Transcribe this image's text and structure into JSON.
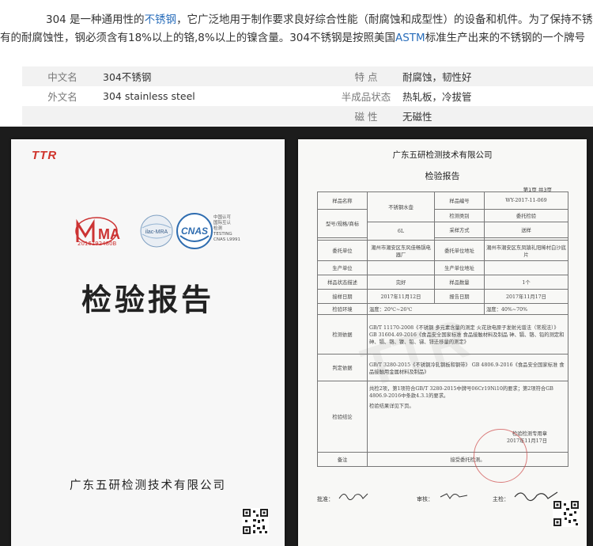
{
  "intro": {
    "line1_a": "304 是一种通用性的",
    "line1_kw": "不锈钢",
    "line1_b": "，它广泛地用于制作要求良好综合性能（耐腐蚀和成型性）的设备和机件。为了保持不锈钢",
    "line2_a": "有的耐腐蚀性，钢必须含有18%以上的铬,8%以上的镍含量。304不锈钢是按照美国",
    "line2_kw": "ASTM",
    "line2_b": "标准生产出来的不锈钢的一个牌号"
  },
  "specs": [
    {
      "k1": "中文名",
      "v1": "304不锈钢",
      "k2": "特  点",
      "v2": "耐腐蚀，韧性好"
    },
    {
      "k1": "外文名",
      "v1": "304 stainless steel",
      "k2": "半成品状态",
      "v2": "热轧板，冷拔管"
    },
    {
      "k1": "",
      "v1": "",
      "k2": "磁  性",
      "v2": "无磁性"
    }
  ],
  "left_doc": {
    "logo_text": "TTR",
    "cma_label": "MA",
    "cma_code": "2016192480B",
    "ilac_label": "ilac-MRA",
    "cnas_label": "CNAS",
    "cnas_lines": [
      "中国认可",
      "国际互认",
      "检测",
      "TESTING",
      "CNAS L9991"
    ],
    "title": "检验报告",
    "company": "广东五研检测技术有限公司"
  },
  "right_doc": {
    "company": "广东五研检测技术有限公司",
    "title": "检验报告",
    "page": "第1页 共3页",
    "sample_name_label": "样品名称",
    "sample_name": "不锈钢水壶",
    "sample_no_label": "样品编号",
    "sample_no": "WY-2017-11-069",
    "model_label": "型号/规格/商标",
    "model": "6L",
    "test_type_label": "检测类别",
    "test_type": "委托检验",
    "sampling_label": "采样方式",
    "sampling": "送样",
    "client_label": "委托单位",
    "client": "潮州市潮安区东风佳畅锅电器厂",
    "client_addr_label": "委托单位地址",
    "client_addr": "潮州市潮安区东凤镇礼阳稀村白沙底片",
    "maker_label": "生产单位",
    "maker_addr_label": "生产单位地址",
    "state_label": "样品状态描述",
    "state": "完好",
    "qty_label": "样品数量",
    "qty": "1个",
    "recv_label": "接样日期",
    "recv": "2017年11月12日",
    "report_date_label": "报告日期",
    "report_date": "2017年11月17日",
    "env_label": "检验环境",
    "env_temp": "温度：20℃~26℃",
    "env_hum": "湿度：40%~70%",
    "basis_label": "检测依据",
    "basis": "GB/T 11170-2008《不锈钢 多元素含量的测定 火花放电原子发射光谱法（常规法）》 GB 31604.49-2016《食品安全国家标准 食品接触材料及制品 砷、镉、铬、铅的测定和砷、镉、铬、镍、铅、锑、锌迁移量的测定》",
    "judge_label": "判定依据",
    "judge": "GB/T 3280-2015《不锈钢冷轧钢板和钢带》 GB 4806.9-2016《食品安全国家标准 食品接触用金属材料及制品》",
    "conclusion_label": "检验结论",
    "conclusion": "共检2项，第1项符合GB/T 3280-2015中牌号06Cr19Ni10的要求；第2项符合GB 4806.9-2016中条款4.3.1的要求。",
    "conclusion_note": "检验结果详见下页。",
    "stamp_text": "检验检测专用章",
    "stamp_date": "2017年11月17日",
    "remark_label": "备注",
    "remark": "接受委托检测。",
    "approve_label": "批准：",
    "review_label": "审核：",
    "main_label": "主检："
  },
  "colors": {
    "link": "#2a6ebb",
    "stamp": "#cd4646",
    "brand": "#d0342c"
  }
}
